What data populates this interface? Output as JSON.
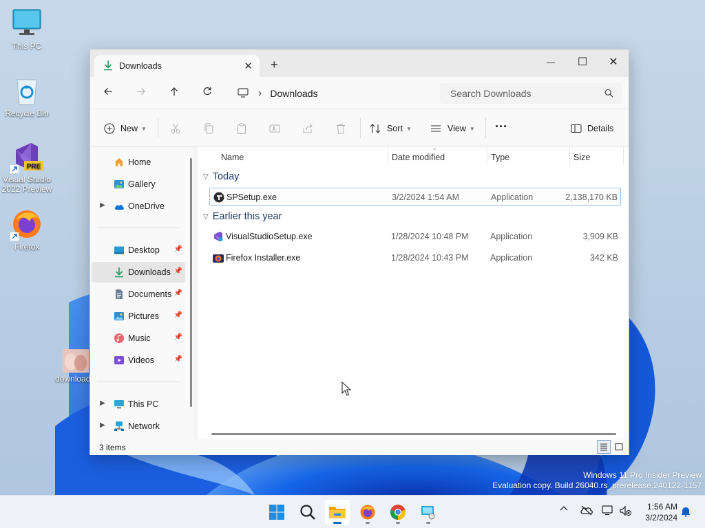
{
  "desktop": {
    "icons": [
      {
        "label": "This PC",
        "icon": "monitor-icon"
      },
      {
        "label": "Recycle Bin",
        "icon": "recycle-bin-icon"
      },
      {
        "label": "Visual Studio 2022 Preview",
        "badge": "PRE",
        "icon": "visual-studio-icon"
      },
      {
        "label": "Firefox",
        "icon": "firefox-icon"
      },
      {
        "label": "download",
        "icon": "image-file-icon"
      }
    ],
    "watermark": {
      "line1": "Windows 11 Pro Insider Preview",
      "line2": "Evaluation copy. Build 26040.rs_prerelease.240122-1157"
    }
  },
  "explorer": {
    "tab": {
      "title": "Downloads",
      "close": "✕",
      "new_tab": "+"
    },
    "window_buttons": {
      "minimize": "—",
      "maximize": "☐",
      "close": "✕"
    },
    "address": {
      "separator": "›",
      "crumb": "Downloads"
    },
    "search": {
      "placeholder": "Search Downloads"
    },
    "toolbar": {
      "new_label": "New",
      "sort_label": "Sort",
      "view_label": "View",
      "more_label": "···",
      "details_label": "Details"
    },
    "nav": {
      "home": "Home",
      "gallery": "Gallery",
      "onedrive": "OneDrive",
      "desktop": "Desktop",
      "downloads": "Downloads",
      "documents": "Documents",
      "pictures": "Pictures",
      "music": "Music",
      "videos": "Videos",
      "thispc": "This PC",
      "network": "Network"
    },
    "columns": {
      "name": "Name",
      "date": "Date modified",
      "type": "Type",
      "size": "Size"
    },
    "groups": [
      {
        "title": "Today",
        "files": [
          {
            "name": "SPSetup.exe",
            "date": "3/2/2024 1:54 AM",
            "type": "Application",
            "size": "2,138,170 KB"
          }
        ]
      },
      {
        "title": "Earlier this year",
        "files": [
          {
            "name": "VisualStudioSetup.exe",
            "date": "1/28/2024 10:48 PM",
            "type": "Application",
            "size": "3,909 KB"
          },
          {
            "name": "Firefox Installer.exe",
            "date": "1/28/2024 10:43 PM",
            "type": "Application",
            "size": "342 KB"
          }
        ]
      }
    ],
    "status": {
      "item_count": "3 items"
    }
  },
  "taskbar": {
    "clock": {
      "time": "1:56 AM",
      "date": "3/2/2024"
    },
    "tray_chevron": "^"
  },
  "colors": {
    "accent": "#0067c0",
    "selection_border": "#99c3ea",
    "group_header": "#1f3b64"
  }
}
